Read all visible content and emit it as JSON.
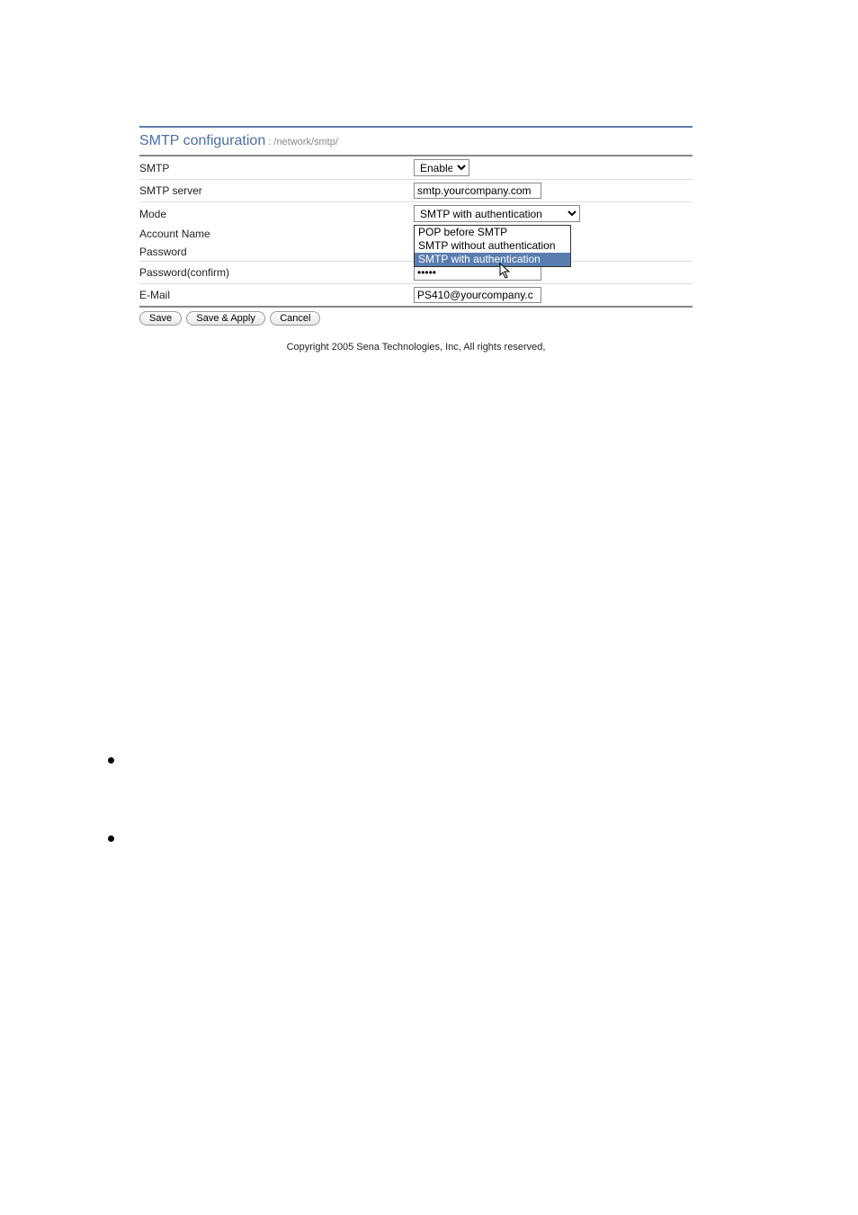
{
  "header": {
    "title": "SMTP configuration",
    "breadcrumb": " : /network/smtp/"
  },
  "form": {
    "smtp": {
      "label": "SMTP",
      "value": "Enable"
    },
    "server": {
      "label": "SMTP server",
      "value": "smtp.yourcompany.com"
    },
    "mode": {
      "label": "Mode",
      "value": "SMTP with authentication",
      "options": {
        "opt1": "POP before SMTP",
        "opt2": "SMTP without authentication",
        "opt3": "SMTP with authentication"
      }
    },
    "account": {
      "label": "Account Name",
      "value": ""
    },
    "password": {
      "label": "Password",
      "value": ""
    },
    "password_confirm": {
      "label": "Password(confirm)",
      "value": "•••••"
    },
    "email": {
      "label": "E-Mail",
      "value": "PS410@yourcompany.c"
    }
  },
  "buttons": {
    "save": "Save",
    "save_apply": "Save & Apply",
    "cancel": "Cancel"
  },
  "footer": {
    "copyright": "Copyright 2005 Sena Technologies, Inc, All rights reserved,"
  }
}
